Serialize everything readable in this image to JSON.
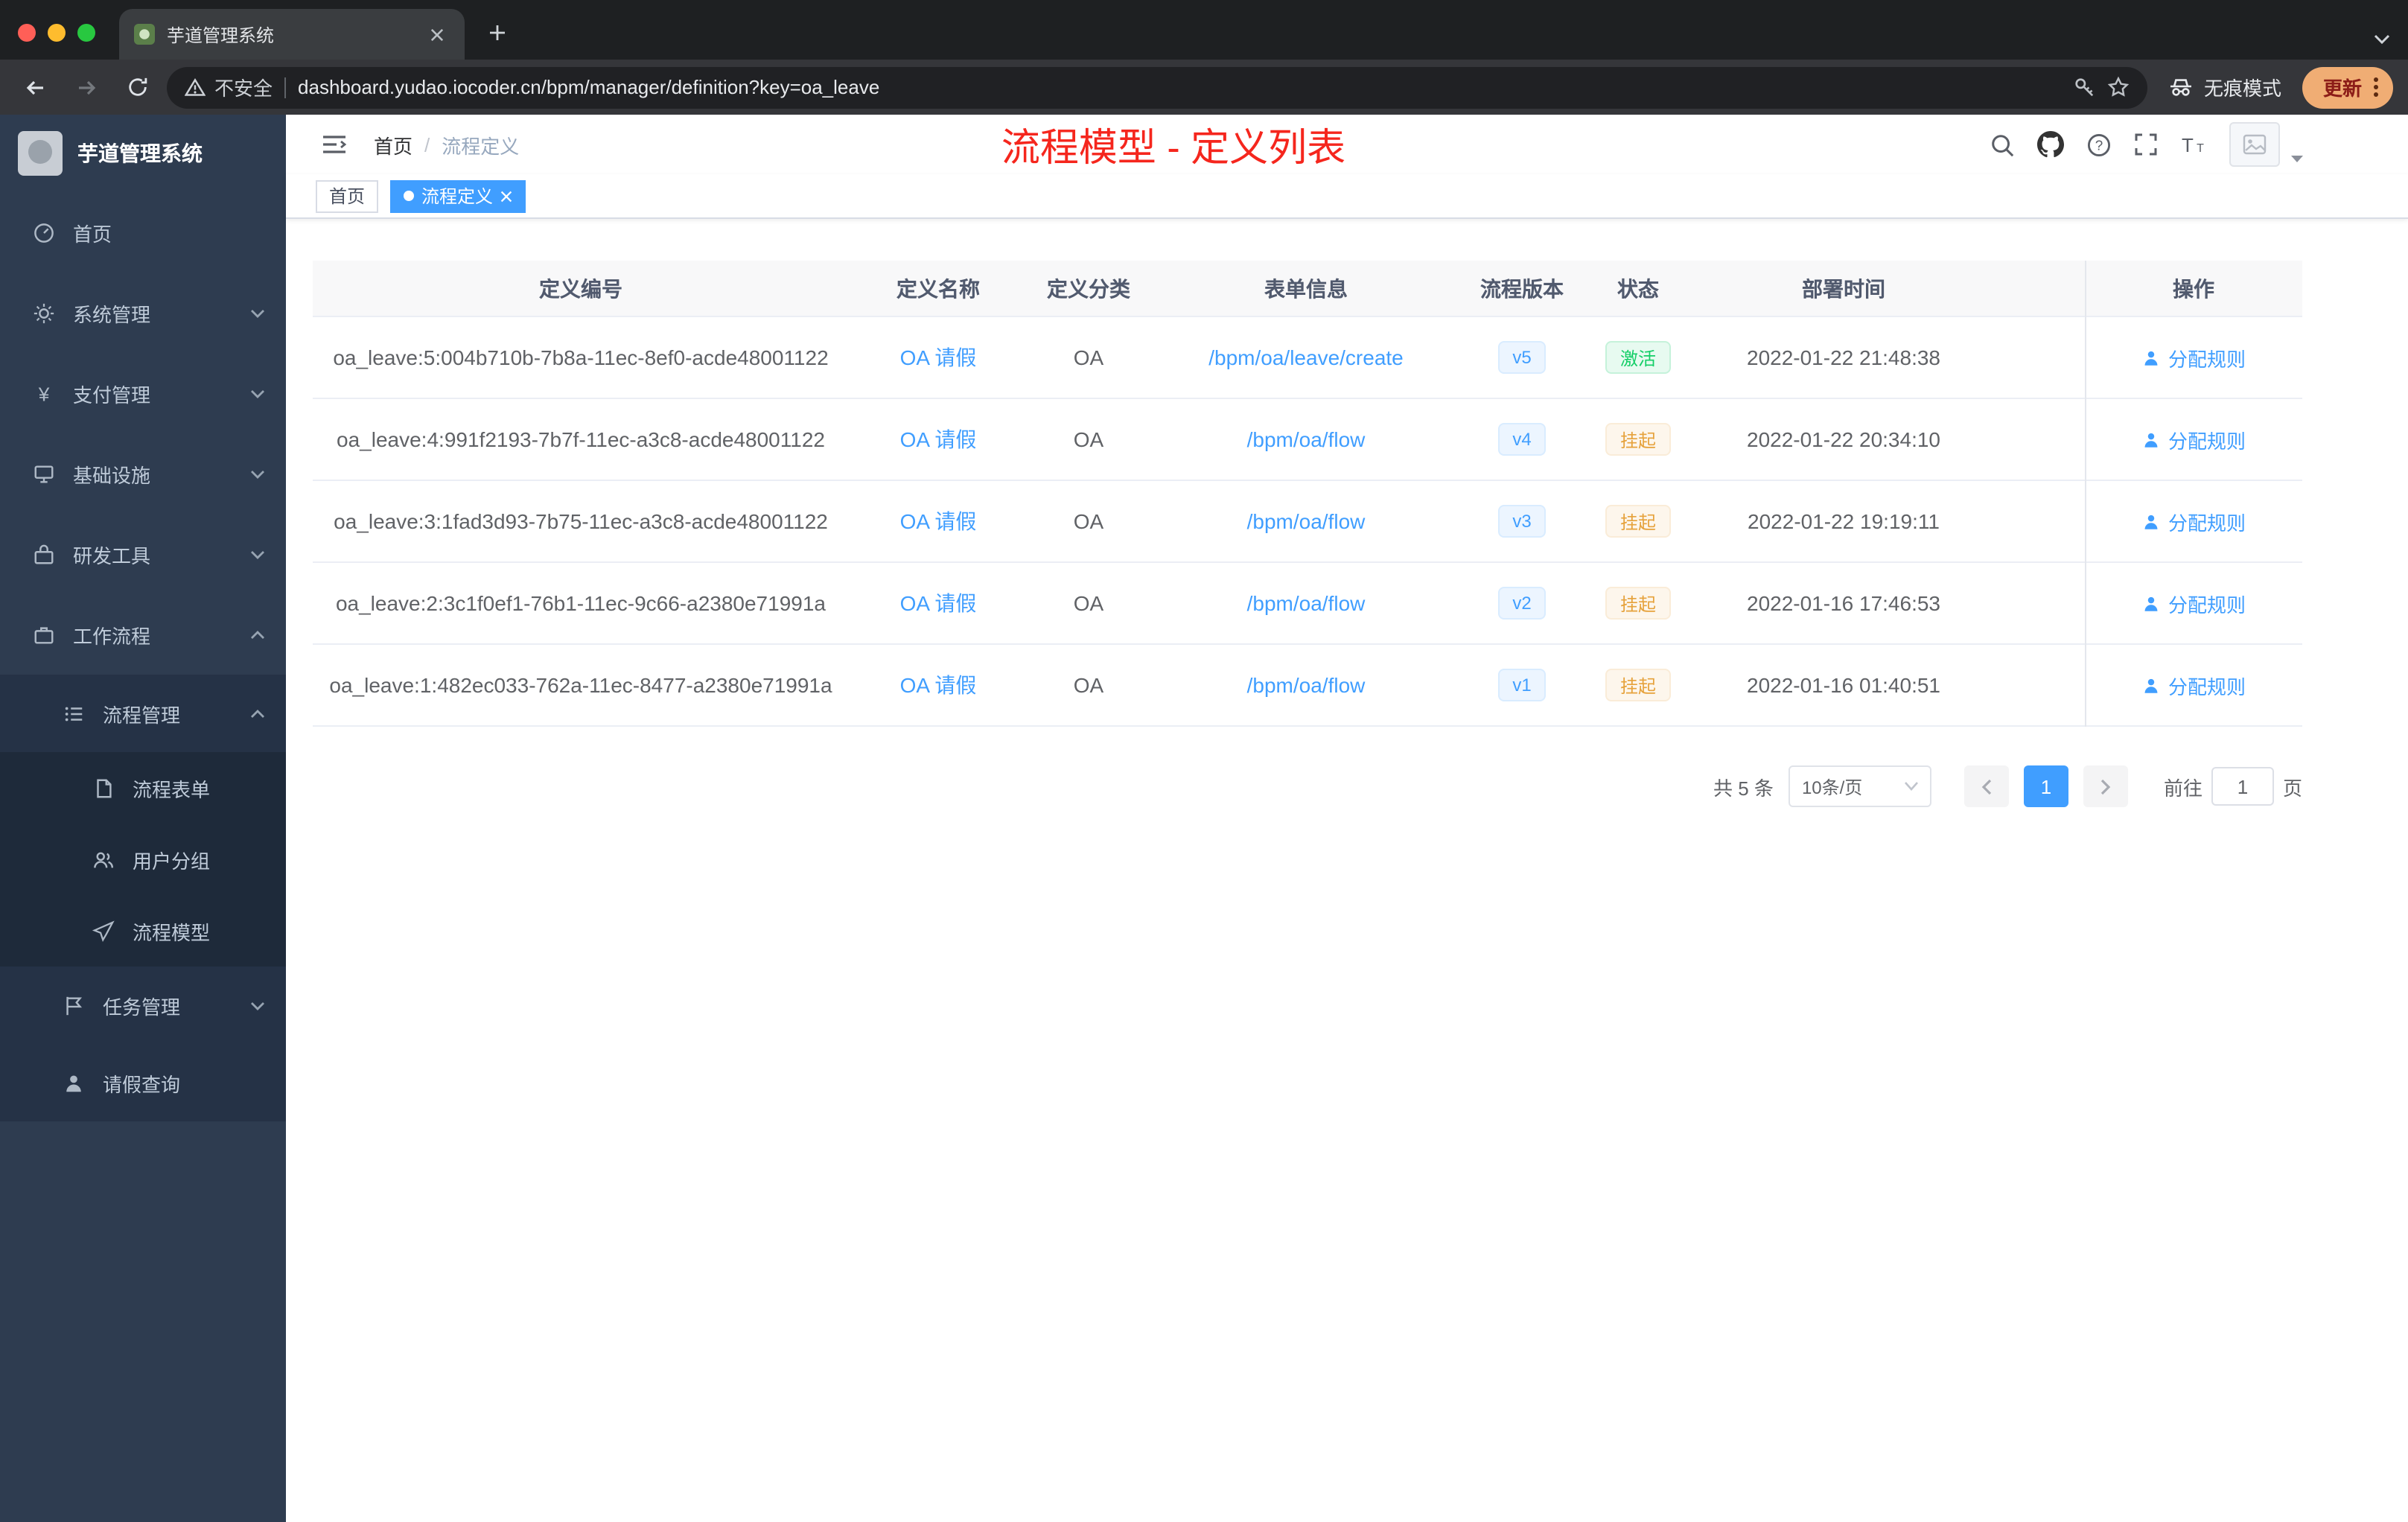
{
  "browser": {
    "tab": {
      "title": "芋道管理系统"
    },
    "address": {
      "security_label": "不安全",
      "url": "dashboard.yudao.iocoder.cn/bpm/manager/definition?key=oa_leave"
    },
    "incognito_label": "无痕模式",
    "update_label": "更新"
  },
  "sidebar": {
    "app_title": "芋道管理系统",
    "menu": [
      {
        "label": "首页"
      },
      {
        "label": "系统管理"
      },
      {
        "label": "支付管理"
      },
      {
        "label": "基础设施"
      },
      {
        "label": "研发工具"
      },
      {
        "label": "工作流程"
      }
    ],
    "submenu": {
      "label": "流程管理",
      "children": [
        {
          "label": "流程表单"
        },
        {
          "label": "用户分组"
        },
        {
          "label": "流程模型"
        }
      ]
    },
    "tail": [
      {
        "label": "任务管理"
      },
      {
        "label": "请假查询"
      }
    ]
  },
  "header": {
    "breadcrumb_home": "首页",
    "breadcrumb_sep": "/",
    "breadcrumb_current": "流程定义",
    "overlay_title": "流程模型 - 定义列表"
  },
  "tags": {
    "home": "首页",
    "active": "流程定义"
  },
  "table": {
    "columns": [
      "定义编号",
      "定义名称",
      "定义分类",
      "表单信息",
      "流程版本",
      "状态",
      "部署时间",
      "操作"
    ],
    "rows": [
      {
        "id": "oa_leave:5:004b710b-7b8a-11ec-8ef0-acde48001122",
        "name": "OA 请假",
        "category": "OA",
        "form": "/bpm/oa/leave/create",
        "version": "v5",
        "status": "激活",
        "time": "2022-01-22 21:48:38",
        "action": "分配规则"
      },
      {
        "id": "oa_leave:4:991f2193-7b7f-11ec-a3c8-acde48001122",
        "name": "OA 请假",
        "category": "OA",
        "form": "/bpm/oa/flow",
        "version": "v4",
        "status": "挂起",
        "time": "2022-01-22 20:34:10",
        "action": "分配规则"
      },
      {
        "id": "oa_leave:3:1fad3d93-7b75-11ec-a3c8-acde48001122",
        "name": "OA 请假",
        "category": "OA",
        "form": "/bpm/oa/flow",
        "version": "v3",
        "status": "挂起",
        "time": "2022-01-22 19:19:11",
        "action": "分配规则"
      },
      {
        "id": "oa_leave:2:3c1f0ef1-76b1-11ec-9c66-a2380e71991a",
        "name": "OA 请假",
        "category": "OA",
        "form": "/bpm/oa/flow",
        "version": "v2",
        "status": "挂起",
        "time": "2022-01-16 17:46:53",
        "action": "分配规则"
      },
      {
        "id": "oa_leave:1:482ec033-762a-11ec-8477-a2380e71991a",
        "name": "OA 请假",
        "category": "OA",
        "form": "/bpm/oa/flow",
        "version": "v1",
        "status": "挂起",
        "time": "2022-01-16 01:40:51",
        "action": "分配规则"
      }
    ]
  },
  "pagination": {
    "total": "共 5 条",
    "page_size": "10条/页",
    "current": "1",
    "goto_label": "前往",
    "goto_value": "1",
    "page_suffix": "页"
  },
  "colors": {
    "accent": "#409eff",
    "title_red": "#f5261d",
    "success": "#13ce66",
    "warning": "#e6a23c",
    "sidebar_bg": "#2e3c50"
  }
}
